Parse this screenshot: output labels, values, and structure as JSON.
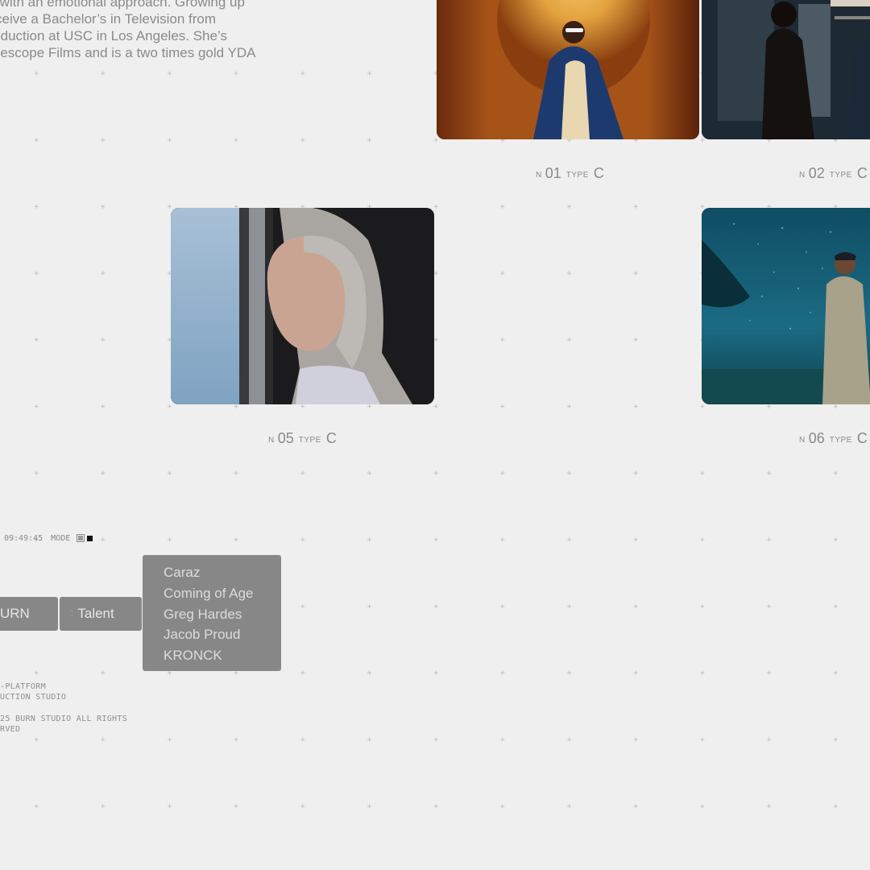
{
  "bio": {
    "lines": [
      "etics with an emotional approach. Growing up",
      "to receive a Bachelor’s in Television from",
      "g Production at USC in Los Angeles. She’s",
      "th Telescope Films and is a two times gold YDA"
    ]
  },
  "tiles": [
    {
      "n_label": "N",
      "number": "01",
      "type_label": "TYPE",
      "type_value": "C"
    },
    {
      "n_label": "N",
      "number": "02",
      "type_label": "TYPE",
      "type_value": "C"
    },
    {
      "n_label": "N",
      "number": "05",
      "type_label": "TYPE",
      "type_value": "C"
    },
    {
      "n_label": "N",
      "number": "06",
      "type_label": "TYPE",
      "type_value": "C"
    }
  ],
  "hud": {
    "time": "09:49:45",
    "mode_label": "MODE",
    "icons": [
      "mode-light-icon",
      "mode-dark-icon"
    ]
  },
  "nav": {
    "brand_label": "URN",
    "talent_label": "Talent",
    "talent_menu": [
      "Caraz",
      "Coming of Age",
      "Greg Hardes",
      "Jacob Proud",
      "KRONCK"
    ]
  },
  "footer": {
    "tagline_lines": [
      "-PLATFORM",
      "UCTION STUDIO"
    ],
    "copyright_lines": [
      "25 BURN STUDIO ALL RIGHTS",
      "RVED"
    ]
  },
  "colors": {
    "background": "#efefef",
    "text": "#8a8a8a",
    "button_bg": "#878787",
    "button_text": "#e6e6e6"
  }
}
